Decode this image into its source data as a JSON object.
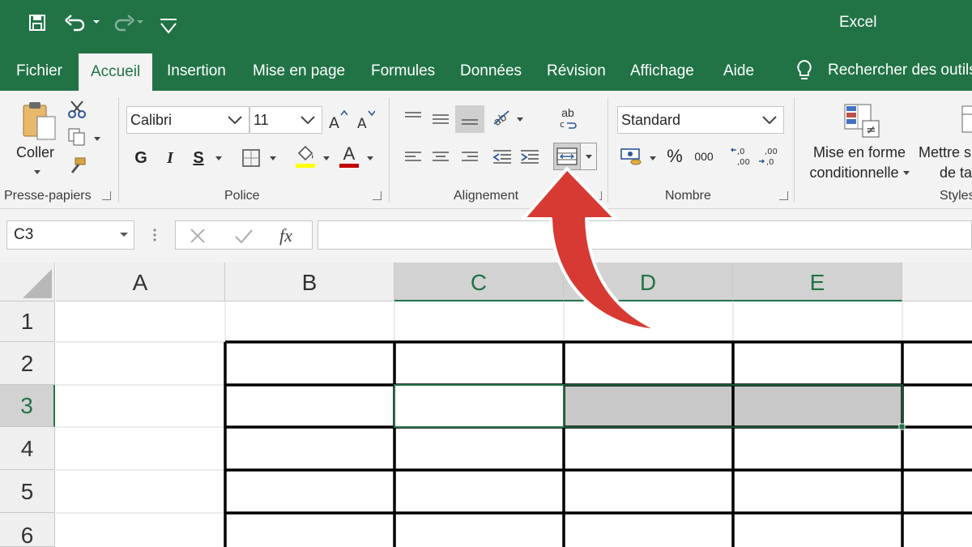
{
  "window": {
    "title": "Excel"
  },
  "quick_access": [
    "save-icon",
    "undo-icon",
    "redo-icon",
    "customize-qat-icon"
  ],
  "tabs": [
    {
      "label": "Fichier",
      "active": false
    },
    {
      "label": "Accueil",
      "active": true
    },
    {
      "label": "Insertion",
      "active": false
    },
    {
      "label": "Mise en page",
      "active": false
    },
    {
      "label": "Formules",
      "active": false
    },
    {
      "label": "Données",
      "active": false
    },
    {
      "label": "Révision",
      "active": false
    },
    {
      "label": "Affichage",
      "active": false
    },
    {
      "label": "Aide",
      "active": false
    }
  ],
  "tell_me": {
    "label": "Rechercher des outils"
  },
  "ribbon": {
    "clipboard": {
      "paste_label": "Coller",
      "group_label": "Presse-papiers"
    },
    "font": {
      "name": "Calibri",
      "size": "11",
      "bold": "G",
      "italic": "I",
      "underline": "S",
      "font_color_glyph": "A",
      "group_label": "Police"
    },
    "alignment": {
      "wrap_glyph": "ab",
      "group_label": "Alignement"
    },
    "number": {
      "format": "Standard",
      "percent": "%",
      "thousands": "000",
      "group_label": "Nombre"
    },
    "styles": {
      "conditional_line1": "Mise en forme",
      "conditional_line2": "conditionnelle",
      "table_line1": "Mettre s",
      "table_line2": "de ta",
      "group_label": "Styles"
    }
  },
  "formula_bar": {
    "name_box": "C3",
    "fx": "fx",
    "value": ""
  },
  "sheet": {
    "columns": [
      "A",
      "B",
      "C",
      "D",
      "E"
    ],
    "rows": [
      "1",
      "2",
      "3",
      "4",
      "5",
      "6"
    ],
    "active_cell": "C3",
    "colors": {
      "accent": "#217346",
      "selected_fill": "#c8c8c8",
      "arrow": "#d63a32"
    }
  }
}
